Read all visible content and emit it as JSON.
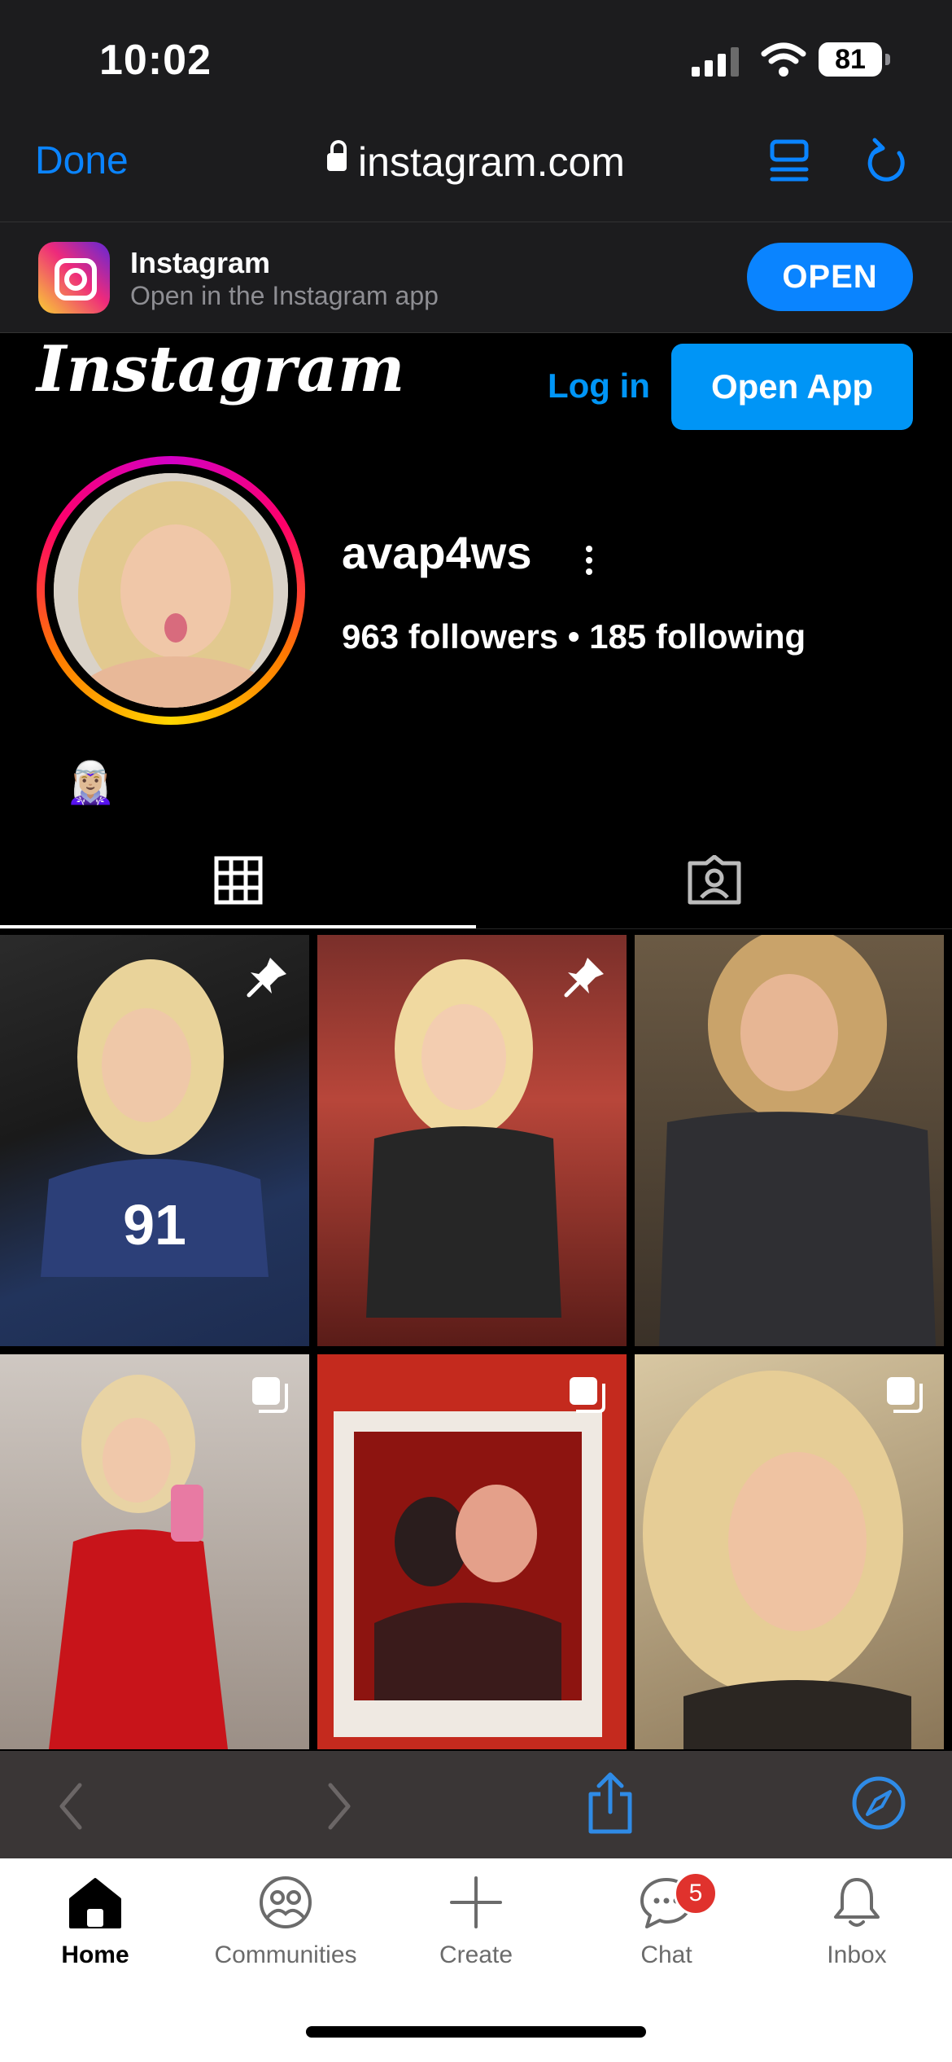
{
  "status_bar": {
    "time": "10:02",
    "battery": "81"
  },
  "browser": {
    "done_label": "Done",
    "url": "instagram.com"
  },
  "app_banner": {
    "title": "Instagram",
    "subtitle": "Open in the Instagram app",
    "open_label": "OPEN"
  },
  "header": {
    "logo": "Instagram",
    "login_label": "Log in",
    "open_app_label": "Open App"
  },
  "profile": {
    "username": "avap4ws",
    "followers": "963 followers",
    "following": "185 following",
    "bio": "🧝🏼‍♀️"
  },
  "tabs": [
    {
      "name": "posts",
      "icon": "grid-icon",
      "active": true
    },
    {
      "name": "tagged",
      "icon": "tagged-icon",
      "active": false
    }
  ],
  "posts": [
    {
      "badge": "pin-icon"
    },
    {
      "badge": "pin-icon"
    },
    {
      "badge": ""
    },
    {
      "badge": "carousel-icon"
    },
    {
      "badge": "carousel-icon"
    },
    {
      "badge": "carousel-icon"
    }
  ],
  "bottom_nav": [
    {
      "label": "Home",
      "icon": "home-icon",
      "active": true
    },
    {
      "label": "Communities",
      "icon": "communities-icon",
      "active": false
    },
    {
      "label": "Create",
      "icon": "create-icon",
      "active": false
    },
    {
      "label": "Chat",
      "icon": "chat-icon",
      "active": false,
      "badge": "5"
    },
    {
      "label": "Inbox",
      "icon": "bell-icon",
      "active": false
    }
  ],
  "colors": {
    "accent": "#0095f6",
    "safari_blue": "#0a84ff"
  }
}
